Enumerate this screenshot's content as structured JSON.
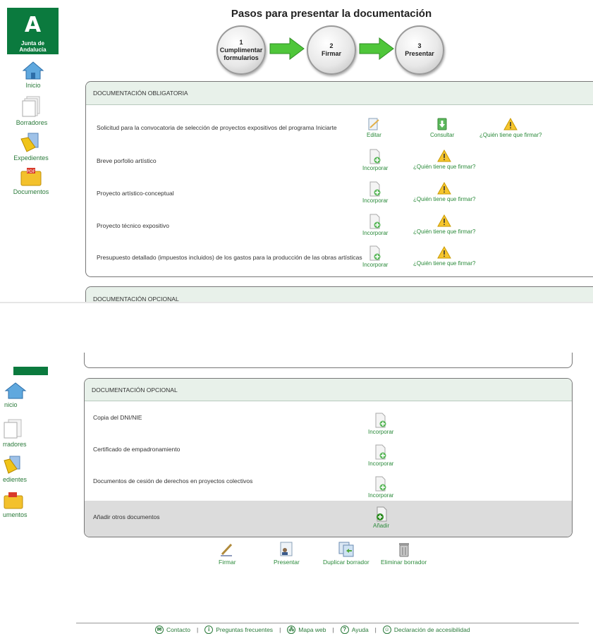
{
  "logo": {
    "mark": "A",
    "text": "Junta de Andalucía"
  },
  "sidebar": {
    "items": [
      {
        "label": "Inicio",
        "icon": "home-icon"
      },
      {
        "label": "Borradores",
        "icon": "drafts-icon"
      },
      {
        "label": "Expedientes",
        "icon": "folder-docs-icon"
      },
      {
        "label": "Documentos",
        "icon": "documents-folder-icon"
      }
    ],
    "items_cropped": [
      "nicio",
      "rradores",
      "edientes",
      "umentos"
    ]
  },
  "steps": {
    "title": "Pasos para presentar la documentación",
    "items": [
      {
        "num": "1",
        "label1": "Cumplimentar",
        "label2": "formularios"
      },
      {
        "num": "2",
        "label1": "Firmar",
        "label2": ""
      },
      {
        "num": "3",
        "label1": "Presentar",
        "label2": ""
      }
    ]
  },
  "obligatoria": {
    "header": "DOCUMENTACIÓN OBLIGATORIA",
    "rows": [
      {
        "label": "Solicitud para la convocatoria de selección de proyectos expositivos del programa Iniciarte",
        "a1": "Editar",
        "a2": "Consultar",
        "a3": "¿Quién tiene que firmar?"
      },
      {
        "label": "Breve porfolio artístico",
        "a1": "Incorporar",
        "a2": "¿Quién tiene que firmar?"
      },
      {
        "label": "Proyecto artístico-conceptual",
        "a1": "Incorporar",
        "a2": "¿Quién tiene que firmar?"
      },
      {
        "label": "Proyecto técnico expositivo",
        "a1": "Incorporar",
        "a2": "¿Quién tiene que firmar?"
      },
      {
        "label": "Presupuesto detallado (impuestos incluidos) de los gastos para la producción de las obras artísticas",
        "a1": "Incorporar",
        "a2": "¿Quién tiene que firmar?"
      }
    ]
  },
  "opcional_top": {
    "header": "DOCUMENTACIÓN OPCIONAL"
  },
  "opcional": {
    "header": "DOCUMENTACIÓN OPCIONAL",
    "rows": [
      {
        "label": "Copia del DNI/NIE",
        "a1": "Incorporar"
      },
      {
        "label": "Certificado de empadronamiento",
        "a1": "Incorporar"
      },
      {
        "label": "Documentos de cesión de derechos en proyectos colectivos",
        "a1": "Incorporar"
      }
    ],
    "add_row": {
      "label": "Añadir otros documentos",
      "a1": "Añadir"
    }
  },
  "actions": [
    {
      "label": "Firmar",
      "icon": "pen-icon"
    },
    {
      "label": "Presentar",
      "icon": "present-icon"
    },
    {
      "label": "Duplicar borrador",
      "icon": "duplicate-icon"
    },
    {
      "label": "Eliminar borrador",
      "icon": "trash-icon"
    }
  ],
  "footer": [
    {
      "label": "Contacto",
      "icon": "mail-icon"
    },
    {
      "label": "Preguntas frecuentes",
      "icon": "info-icon"
    },
    {
      "label": "Mapa web",
      "icon": "sitemap-icon"
    },
    {
      "label": "Ayuda",
      "icon": "help-icon"
    },
    {
      "label": "Declaración de accesibilidad",
      "icon": "accessibility-icon"
    }
  ],
  "colors": {
    "brand": "#0b7a3e",
    "link": "#2a8a3a",
    "header_bg": "#e8f1ea",
    "add_row_bg": "#dcdcdc"
  }
}
